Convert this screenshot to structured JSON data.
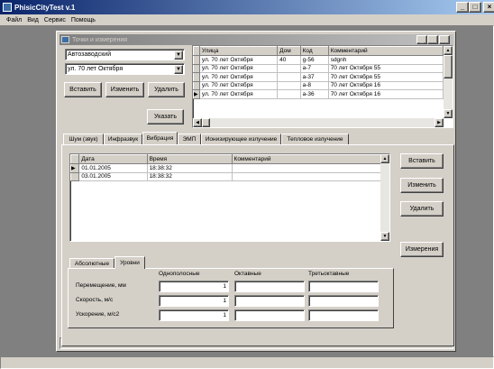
{
  "app": {
    "title": "PhisicCityTest v.1"
  },
  "menu": [
    "Файл",
    "Вид",
    "Сервис",
    "Помощь"
  ],
  "window": {
    "title": "Точки и измерения"
  },
  "left_panel": {
    "district": "Автозаводский",
    "street": "ул. 70 лет Октября",
    "insert_label": "Вставить",
    "edit_label": "Изменить",
    "delete_label": "Удалить",
    "point_label": "Указать"
  },
  "address_grid": {
    "columns": [
      "Улица",
      "Дом",
      "Код",
      "Комментарий"
    ],
    "rows": [
      [
        "ул. 70 лет Октября",
        "40",
        "g-56",
        "sdgnh"
      ],
      [
        "ул. 70 лет Октября",
        "",
        "a-7",
        "70 лет Октября 55"
      ],
      [
        "ул. 70 лет Октября",
        "",
        "a-37",
        "70 лет Октября 55"
      ],
      [
        "ул. 70 лет Октября",
        "",
        "a-8",
        "70 лет Октября 16"
      ],
      [
        "ул. 70 лет Октября",
        "",
        "a-36",
        "70 лет Октября 16"
      ]
    ]
  },
  "tabs": [
    "Шум (звук)",
    "Инфразвук",
    "Вибрация",
    "ЭМП",
    "Ионизирующее излучение",
    "Тепловое излучение"
  ],
  "measure_grid": {
    "columns": [
      "Дата",
      "Время",
      "Комментарий"
    ],
    "rows": [
      [
        "01.01.2005",
        "18:38:32",
        ""
      ],
      [
        "03.01.2005",
        "18:38:32",
        ""
      ]
    ]
  },
  "right_buttons": {
    "insert_label": "Вставить",
    "edit_label": "Изменить",
    "delete_label": "Удалить",
    "measure_label": "Измерения"
  },
  "sub_tabs": [
    "Абсолютные",
    "Уровни"
  ],
  "values": {
    "headers": [
      "Однополосные",
      "Октавные",
      "Третьоктавные"
    ],
    "rows": [
      {
        "label": "Перемещение, мм",
        "single": "1",
        "octave": "",
        "third": ""
      },
      {
        "label": "Скорость, м/с",
        "single": "1",
        "octave": "",
        "third": ""
      },
      {
        "label": "Ускорение, м/с2",
        "single": "1",
        "octave": "",
        "third": ""
      }
    ]
  }
}
